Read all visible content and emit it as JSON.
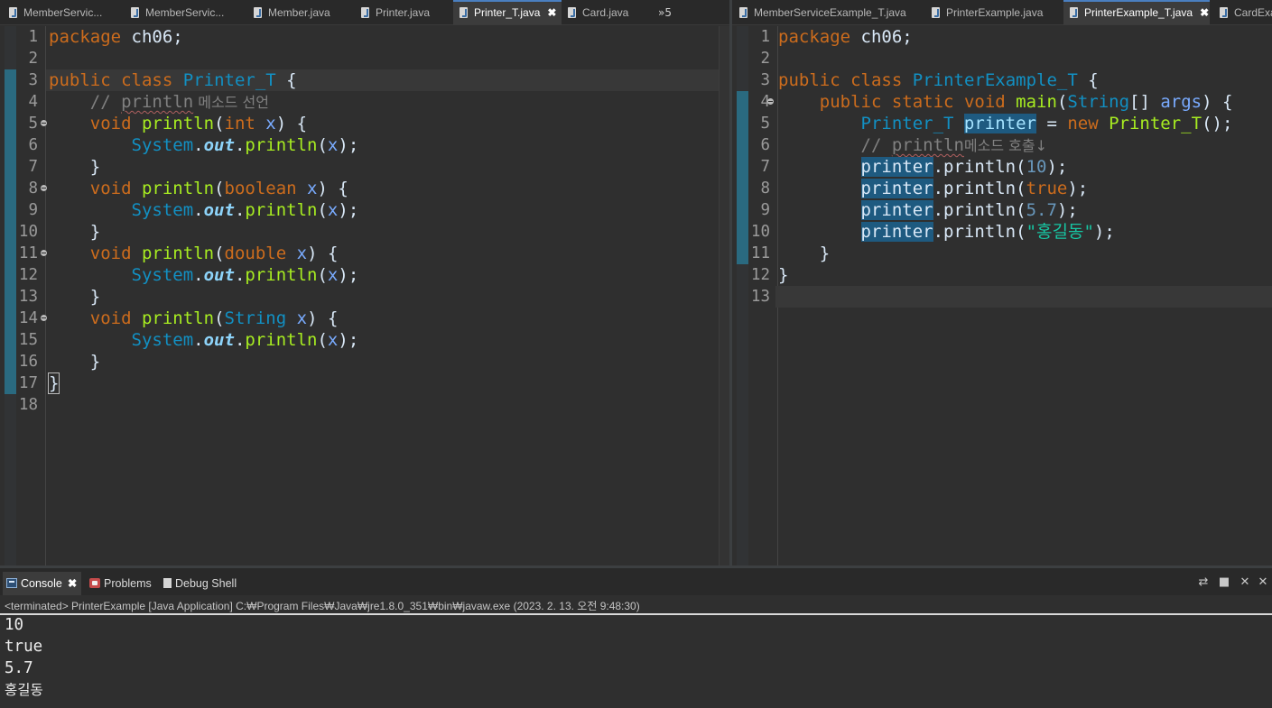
{
  "left_editor": {
    "tabs": [
      {
        "label": "MemberServic...",
        "active": false
      },
      {
        "label": "MemberServic...",
        "active": false
      },
      {
        "label": "Member.java",
        "active": false
      },
      {
        "label": "Printer.java",
        "active": false
      },
      {
        "label": "Printer_T.java",
        "active": true
      },
      {
        "label": "Card.java",
        "active": false
      }
    ],
    "overflow_label": "»5",
    "close_glyph": "✖",
    "line_numbers": [
      "1",
      "2",
      "3",
      "4",
      "5",
      "6",
      "7",
      "8",
      "9",
      "10",
      "11",
      "12",
      "13",
      "14",
      "15",
      "16",
      "17",
      "18"
    ],
    "code": {
      "pkg_kw": "package",
      "pkg_rest": " ch06;",
      "public": "public",
      "class": "class",
      "class_name": "Printer_T",
      "open_brace": " {",
      "comment_slash": "    // ",
      "comment_word": "println",
      "comment_kr": " 메소드 선언",
      "void": "void",
      "println": "println",
      "x": "x",
      "int": "int",
      "boolean": "boolean",
      "double": "double",
      "string_type": "String",
      "system": "System",
      "out": "out",
      "close_brace": "}"
    }
  },
  "right_editor": {
    "tabs": [
      {
        "label": "MemberServiceExample_T.java",
        "active": false
      },
      {
        "label": "PrinterExample.java",
        "active": false
      },
      {
        "label": "PrinterExample_T.java",
        "active": true
      },
      {
        "label": "CardExa",
        "active": false
      }
    ],
    "close_glyph": "✖",
    "line_numbers": [
      "1",
      "2",
      "3",
      "4",
      "5",
      "6",
      "7",
      "8",
      "9",
      "10",
      "11",
      "12",
      "13"
    ],
    "code": {
      "pkg_kw": "package",
      "pkg_rest": " ch06;",
      "public": "public",
      "class": "class",
      "class_name": "PrinterExample_T",
      "static": "static",
      "void": "void",
      "main": "main",
      "string_type": "String",
      "args": "args",
      "type": "Printer_T",
      "var": "printer",
      "new": "new",
      "ctor": "Printer_T",
      "comment_slash": "// ",
      "comment_word": "println",
      "comment_kr": "메소드 호출↓",
      "println": "println",
      "arg_int": "10",
      "arg_bool": "true",
      "arg_double": "5.7",
      "arg_str": "\"홍길동\""
    }
  },
  "console": {
    "tabs": [
      {
        "label": "Console",
        "active": true,
        "icon": "console-icon"
      },
      {
        "label": "Problems",
        "active": false,
        "icon": "problems-icon"
      },
      {
        "label": "Debug Shell",
        "active": false,
        "icon": "debug-shell-icon"
      }
    ],
    "close_glyph": "✖",
    "toolbar_icons": [
      "pin-icon",
      "terminate-icon",
      "remove-launch-icon",
      "remove-all-icon"
    ],
    "status": "<terminated> PrinterExample [Java Application] C:₩Program Files₩Java₩jre1.8.0_351₩bin₩javaw.exe  (2023. 2. 13. 오전 9:48:30)",
    "output": [
      "10",
      "true",
      "5.7",
      "홍길동"
    ]
  },
  "colors": {
    "background": "#2f2f2f",
    "keyword": "#cc6c1d",
    "class": "#1290c3",
    "method": "#a7ec21",
    "variable": "#79abff",
    "field": "#8dd3f9",
    "string": "#17c6a3",
    "comment": "#808080",
    "selection": "#1e5a80"
  }
}
